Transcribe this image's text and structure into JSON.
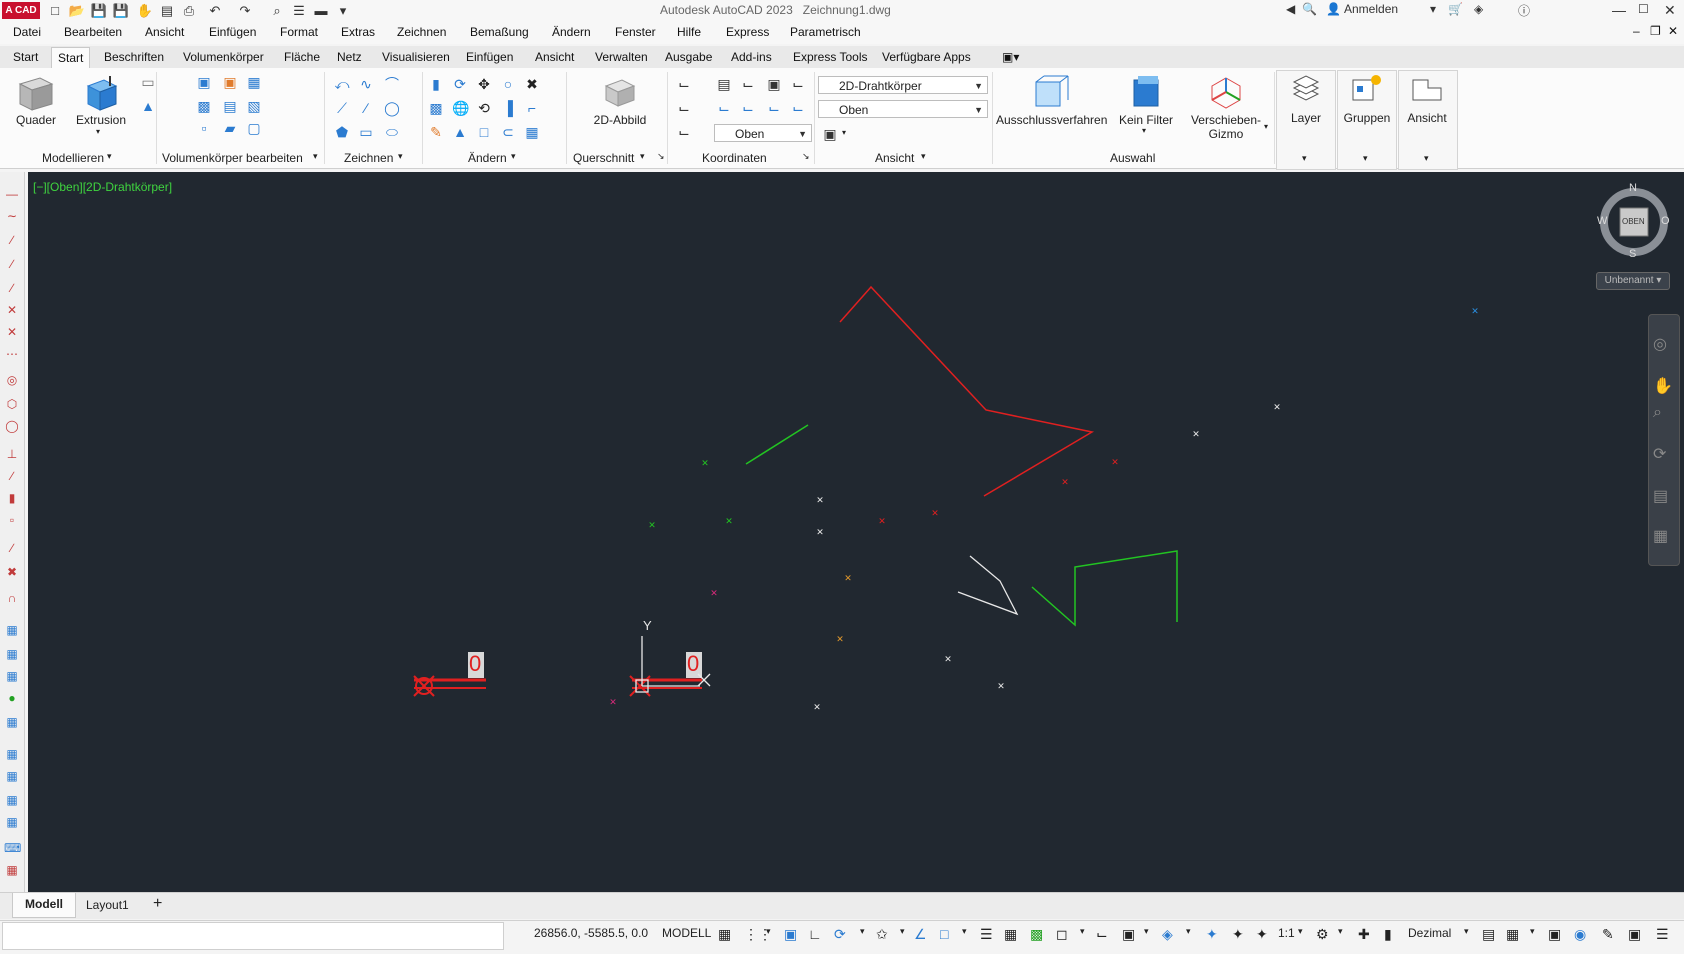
{
  "app": {
    "logo": "A CAD",
    "window_title": "Autodesk AutoCAD 2023",
    "file_name": "Zeichnung1.dwg",
    "signin": "Anmelden"
  },
  "menus": [
    "Datei",
    "Bearbeiten",
    "Ansicht",
    "Einfügen",
    "Format",
    "Extras",
    "Zeichnen",
    "Bemaßung",
    "Ändern",
    "Fenster",
    "Hilfe",
    "Express",
    "Parametrisch"
  ],
  "ribbon_tabs": [
    "Start",
    "Start",
    "Beschriften",
    "Volumenkörper",
    "Fläche",
    "Netz",
    "Visualisieren",
    "Einfügen",
    "Ansicht",
    "Verwalten",
    "Ausgabe",
    "Add-ins",
    "Express Tools",
    "Verfügbare Apps"
  ],
  "ribbon": {
    "quader": "Quader",
    "extrusion": "Extrusion",
    "panel_modellieren": "Modellieren",
    "panel_vk_bearbeiten": "Volumenkörper bearbeiten",
    "panel_zeichnen": "Zeichnen",
    "panel_aendern": "Ändern",
    "abbild": "2D-Abbild",
    "panel_querschnitt": "Querschnitt",
    "panel_koordinaten": "Koordinaten",
    "visual_style": "2D-Drahtkörper",
    "view_name": "Oben",
    "ucs_name": "Oben",
    "panel_ansicht": "Ansicht",
    "ausschluss": "Ausschlussverfahren",
    "kein_filter": "Kein Filter",
    "gizmo_line1": "Verschieben-",
    "gizmo_line2": "Gizmo",
    "panel_auswahl": "Auswahl",
    "layer": "Layer",
    "gruppen": "Gruppen",
    "ansicht": "Ansicht"
  },
  "viewport": {
    "label": "[−][Oben][2D-Drahtkörper]",
    "viewcube_face": "OBEN",
    "compass": {
      "n": "N",
      "s": "S",
      "w": "W",
      "o": "O"
    },
    "wcs_label": "Unbenannt",
    "text_markers": [
      "0",
      "0"
    ],
    "ucs_y": "Y"
  },
  "layout_tabs": [
    "Modell",
    "Layout1",
    "+"
  ],
  "status": {
    "coords": "26856.0, -5585.5, 0.0",
    "mode": "MODELL",
    "scale": "1:1",
    "units": "Dezimal"
  },
  "colors": {
    "canvas": "#212830",
    "red": "#e02020",
    "green": "#22c422",
    "white": "#e8e8e8",
    "magenta": "#d82a7a",
    "orange": "#e39a2c",
    "accent": "#2b7bd0"
  }
}
